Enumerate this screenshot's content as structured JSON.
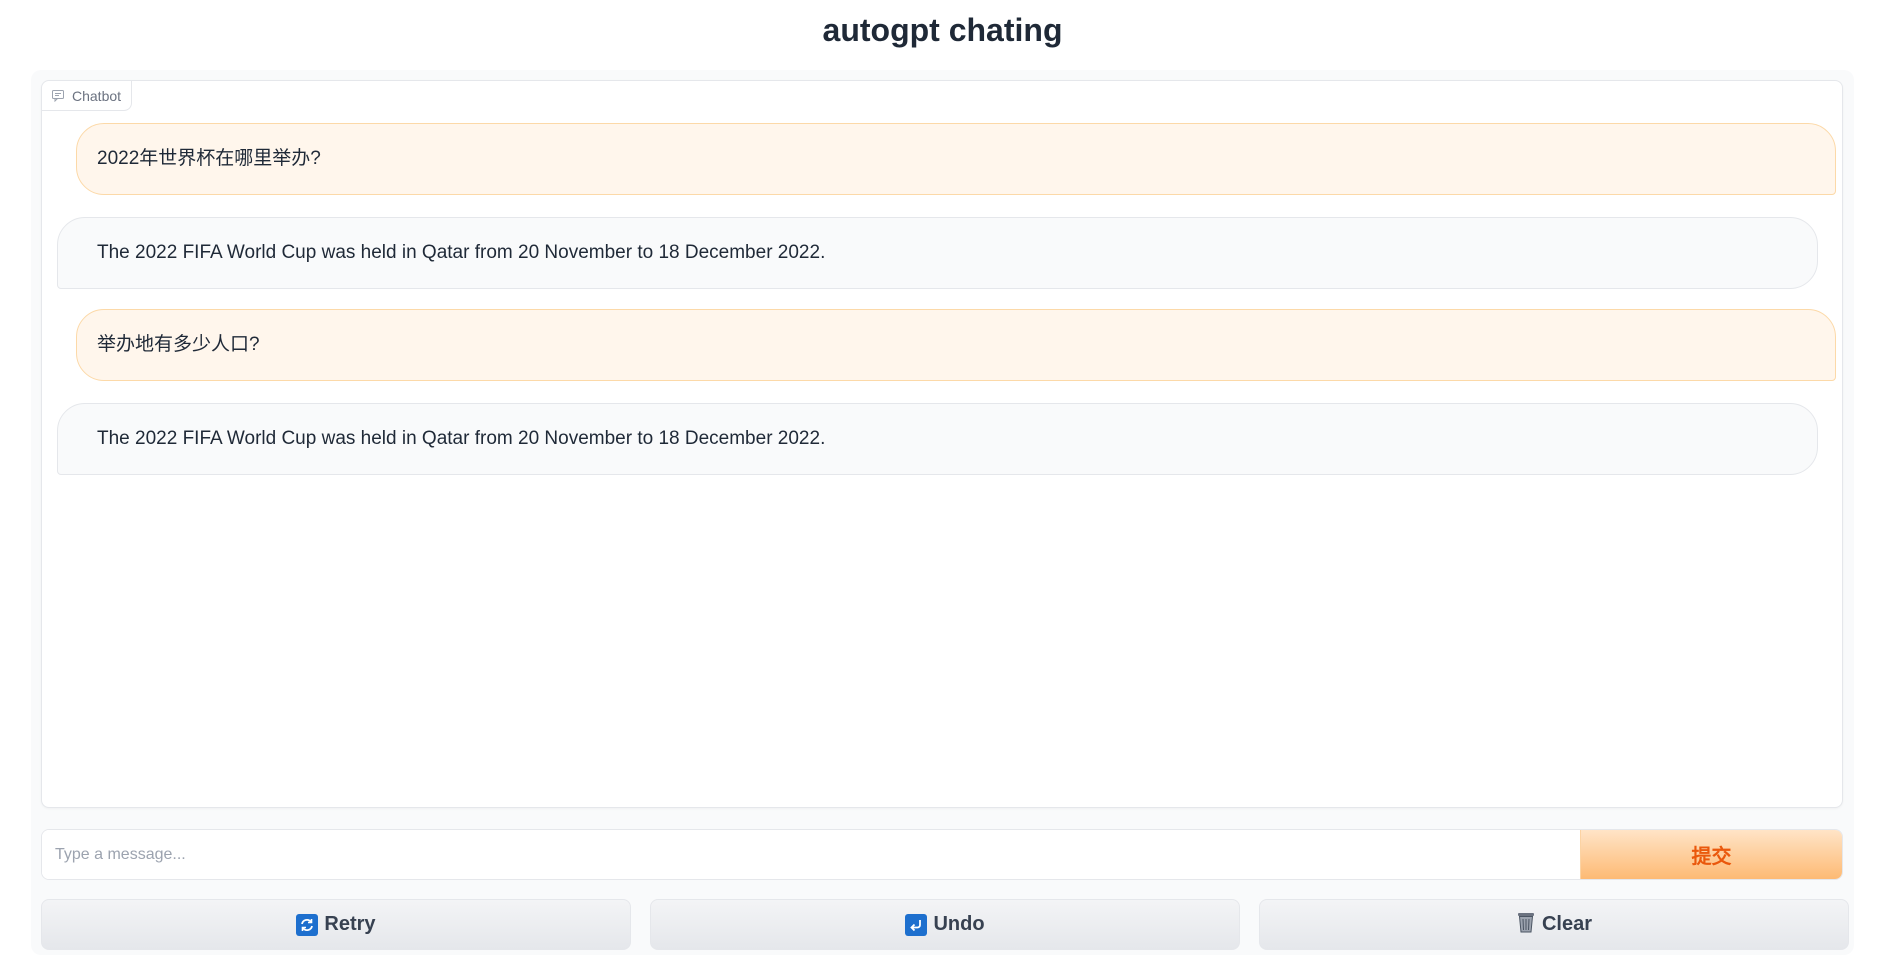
{
  "page": {
    "title": "autogpt chating"
  },
  "chatbot": {
    "label": "Chatbot",
    "messages": [
      {
        "role": "user",
        "text": "2022年世界杯在哪里举办?"
      },
      {
        "role": "bot",
        "text": "The 2022 FIFA World Cup was held in Qatar from 20 November to 18 December 2022."
      },
      {
        "role": "user",
        "text": "举办地有多少人口?"
      },
      {
        "role": "bot",
        "text": "The 2022 FIFA World Cup was held in Qatar from 20 November to 18 December 2022."
      }
    ]
  },
  "input": {
    "placeholder": "Type a message...",
    "value": "",
    "submit_label": "提交"
  },
  "buttons": {
    "retry_label": "Retry",
    "undo_label": "Undo",
    "clear_label": "Clear"
  },
  "icons": {
    "chatbot": "chat-bubble-icon",
    "retry": "repeat-arrows-icon",
    "undo": "return-arrow-icon",
    "clear": "wastebasket-icon"
  },
  "colors": {
    "user_bubble_bg": "#fff6ec",
    "user_bubble_border": "#fcd9a8",
    "bot_bubble_bg": "#f9fafb",
    "submit_text": "#ea580c",
    "submit_gradient_end": "#fdba74"
  }
}
